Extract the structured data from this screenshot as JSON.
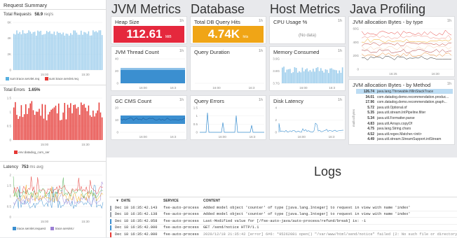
{
  "sidebar": {
    "title": "Request Summary",
    "total_requests": {
      "label": "Total Requests",
      "value": "58.9",
      "unit": "req/s",
      "y_ticks": [
        "6K",
        "4K",
        "2K",
        "0"
      ],
      "x_ticks": [
        "15:00",
        "15:30"
      ],
      "legend": [
        "sum:trace.servlet.req",
        "sum:trace.servlet.req"
      ],
      "legend_colors": [
        "#57b0e0",
        "#e53935"
      ]
    },
    "total_errors": {
      "label": "Total Errors",
      "value": "1.65%",
      "y_ticks": [
        "1.5",
        "1",
        "0.5",
        "0"
      ],
      "x_ticks": [
        "15:00",
        "15:30"
      ],
      "legend": [
        "env:datadog_com_ser"
      ],
      "legend_colors": [
        "#e53935"
      ]
    },
    "latency": {
      "label": "Latency",
      "value": "753",
      "unit": "ms avg",
      "y_ticks": [
        "2",
        "1.5",
        "1",
        "0.5",
        "0"
      ],
      "x_ticks": [
        "15:00",
        "15:30"
      ],
      "legend": [
        "trace.servlet.request",
        "trace.servlet.r"
      ],
      "legend_colors": [
        "#3b8fd0",
        "#9b7fd4"
      ]
    }
  },
  "sections": {
    "jvm": "JVM Metrics",
    "database": "Database",
    "host": "Host Metrics",
    "profiling": "Java Profiling",
    "logs": "Logs"
  },
  "widgets": {
    "heap_size": {
      "title": "Heap Size",
      "value": "112.61",
      "unit": "MiB",
      "ts": "1h",
      "color": "#e5283d"
    },
    "db_query_hits": {
      "title": "Total DB Query Hits",
      "value": "4.74K",
      "unit": "hits",
      "ts": "1h",
      "color": "#f0a516"
    },
    "cpu_usage": {
      "title": "CPU Usage %",
      "nodata": "(No data)",
      "ts": "1h"
    },
    "jvm_thread": {
      "title": "JVM Thread Count",
      "ts": "1h",
      "y_ticks": [
        "40",
        "20",
        "0"
      ],
      "x_ticks": [
        "16:00",
        "16:3"
      ]
    },
    "query_duration": {
      "title": "Query Duration",
      "ts": "1h",
      "x_ticks": [
        "16:00",
        "16:3"
      ]
    },
    "memory_consumed": {
      "title": "Memory Consumed",
      "ts": "1h",
      "y_ticks": [
        "3.9G",
        "3.8G",
        "3.7G"
      ],
      "x_ticks": [
        "16:00",
        "16:3"
      ]
    },
    "gc_cms": {
      "title": "GC CMS Count",
      "ts": "1h",
      "y_ticks": [
        "20",
        "10",
        "0"
      ],
      "x_ticks": [
        "16:00",
        "16:3"
      ]
    },
    "query_errors": {
      "title": "Query Errors",
      "ts": "1h",
      "y_ticks": [
        "1.5",
        "1",
        "0.5",
        "0"
      ],
      "x_ticks": [
        "16:00",
        "16:3"
      ]
    },
    "disk_latency": {
      "title": "Disk Latency",
      "ts": "1h",
      "y_ticks": [
        "4",
        "2",
        "0"
      ],
      "x_ticks": [
        "16:00",
        "16:3"
      ]
    },
    "alloc_type": {
      "title": "JVM allocation Bytes - by type",
      "ts": "1h",
      "y_ticks": [
        "60G",
        "40G",
        "20G",
        "0"
      ],
      "x_ticks": [
        "16:25",
        "16:30"
      ]
    },
    "alloc_method": {
      "title": "JVM allocation Bytes - by Method",
      "ts": "1h",
      "axis_label": "malloc/bytes",
      "rows": [
        {
          "v": "126.74",
          "m": "java.lang.Throwable.fillInStackTrace",
          "hl": true
        },
        {
          "v": "34.01",
          "m": "com.datadog.demo.recommendation.produc..."
        },
        {
          "v": "17.96",
          "m": "com.datadog.demo.recommendation.graph..."
        },
        {
          "v": "5.72",
          "m": "java.util.Optional.of"
        },
        {
          "v": "5.35",
          "m": "java.util.stream.IntPipeline.filter"
        },
        {
          "v": "5.34",
          "m": "java.util.Formatter.parse"
        },
        {
          "v": "4.83",
          "m": "java.util.Arrays.copyOf"
        },
        {
          "v": "4.75",
          "m": "java.lang.String.chars"
        },
        {
          "v": "4.52",
          "m": "java.util.regex.Matcher.<init>"
        },
        {
          "v": "4.49",
          "m": "java.util.stream.StreamSupport.intStream"
        }
      ]
    }
  },
  "logs": {
    "columns": [
      "DATE",
      "SERVICE",
      "CONTENT"
    ],
    "rows": [
      {
        "date": "Dec 18 16:35:42.143",
        "service": "fse-auto-process",
        "content": "Added model object 'counter' of type [java.lang.Integer] to request in view with name 'index'",
        "color": "#9aa0a8"
      },
      {
        "date": "Dec 18 16:35:42.138",
        "service": "fse-auto-process",
        "content": "Added model object 'counter' of type [java.lang.Integer] to request in view with name 'index'",
        "color": "#9aa0a8"
      },
      {
        "date": "Dec 18 16:35:42.058",
        "service": "fse-auto-process",
        "content": "Last-Modified value for [/fse-auto-java/auto-process/refund/break] is: -1",
        "color": "#3b8fd0"
      },
      {
        "date": "Dec 18 16:35:42.000",
        "service": "fse-auto-process",
        "content": "GET /send/notice HTTP/1.1",
        "color": "#3b8fd0"
      },
      {
        "date": "Dec 18 16:35:42.000",
        "service": "fse-auto-process",
        "content": "2020/12/18 21:35:42 [error] 6#6: *95262081 open() \"/var/www/html/send/notice\" failed (2: No such file or directory",
        "color": "#e53935"
      }
    ]
  }
}
